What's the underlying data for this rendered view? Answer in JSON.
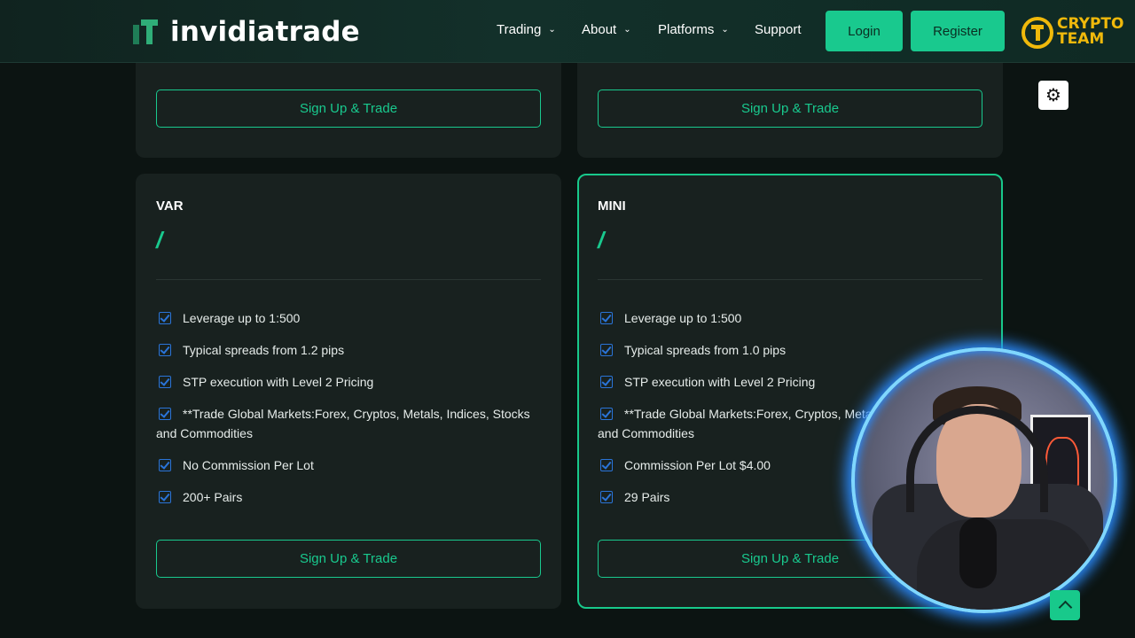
{
  "header": {
    "brand": "invidiatrade",
    "nav": [
      {
        "label": "Trading",
        "dropdown": true
      },
      {
        "label": "About",
        "dropdown": true
      },
      {
        "label": "Platforms",
        "dropdown": true
      },
      {
        "label": "Support",
        "dropdown": false
      }
    ],
    "login_label": "Login",
    "register_label": "Register",
    "partner_logo_text": [
      "CRYPTO",
      "TEAM"
    ]
  },
  "top_cards": [
    {
      "button_label": "Sign Up & Trade"
    },
    {
      "button_label": "Sign Up & Trade"
    }
  ],
  "plans": [
    {
      "name": "VAR",
      "price": "/",
      "features": [
        "Leverage up to 1:500",
        "Typical spreads from 1.2 pips",
        "STP execution with Level 2 Pricing",
        "**Trade Global Markets:Forex, Cryptos, Metals, Indices, Stocks and Commodities",
        "No Commission Per Lot",
        "200+ Pairs"
      ],
      "button_label": "Sign Up & Trade",
      "highlighted": false
    },
    {
      "name": "MINI",
      "price": "/",
      "features": [
        "Leverage up to 1:500",
        "Typical spreads from 1.0 pips",
        "STP execution with Level 2 Pricing",
        "**Trade Global Markets:Forex, Cryptos, Metals, Indices, Stocks and Commodities",
        "Commission Per Lot $4.00",
        "29 Pairs"
      ],
      "button_label": "Sign Up & Trade",
      "highlighted": true
    }
  ],
  "icons": {
    "settings": "gear-icon",
    "scroll_top": "chevron-up-icon",
    "feature_check": "checkbox-icon"
  },
  "colors": {
    "accent": "#19c98e",
    "background": "#0c1412",
    "card": "#18211f",
    "check": "#2a74d8",
    "partner_logo": "#f0b90b"
  }
}
